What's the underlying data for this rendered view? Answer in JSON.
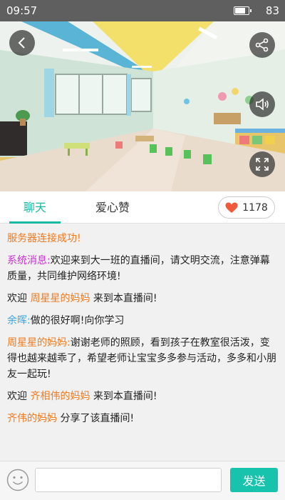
{
  "status_bar": {
    "time": "09:57",
    "battery_level": 83,
    "battery_text": "83"
  },
  "video": {
    "back_icon": "chevron-left-icon",
    "share_icon": "share-icon",
    "volume_icon": "speaker-icon",
    "fullscreen_icon": "fullscreen-icon"
  },
  "tabs": [
    {
      "label": "聊天",
      "active": true
    },
    {
      "label": "爱心赞",
      "active": false
    }
  ],
  "likes": {
    "count": "1178",
    "icon": "heart-icon",
    "color": "#f05a3a"
  },
  "chat": {
    "m1": "服务器连接成功!",
    "m2_label": "系统消息:",
    "m2_text": "欢迎来到大一班的直播间，请文明交流，注意弹幕质量，共同维护网络环境!",
    "m3_pre": "欢迎",
    "m3_name": "周星星的妈妈",
    "m3_post": "来到本直播间!",
    "m4_name": "余晖:",
    "m4_text": "做的很好啊!向你学习",
    "m5_name": "周星星的妈妈:",
    "m5_text": "谢谢老师的照顾，看到孩子在教室很活泼，变得也越来越乖了，希望老师让宝宝多多参与活动，多多和小朋友一起玩!",
    "m6_pre": "欢迎",
    "m6_name": "齐相伟的妈妈",
    "m6_post": "来到本直播间!",
    "m7_name": "齐伟的妈妈",
    "m7_post": "分享了该直播间!"
  },
  "input": {
    "placeholder": "",
    "value": "",
    "send_label": "发送"
  },
  "colors": {
    "accent": "#18c3ad",
    "orange": "#f07a1e",
    "magenta": "#cc2fd4",
    "blue": "#38a6e0"
  }
}
